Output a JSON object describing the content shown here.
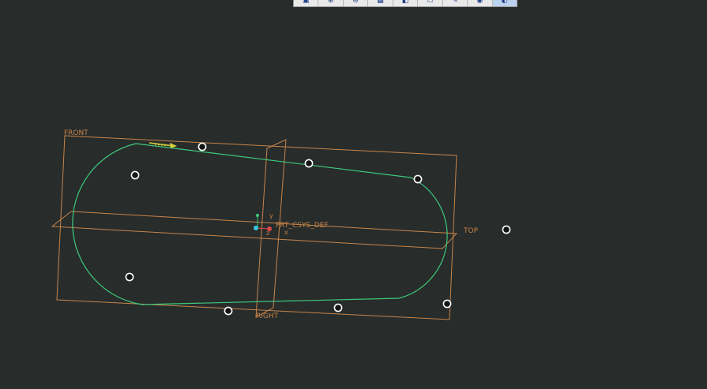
{
  "datum_planes": {
    "front": "FRONT",
    "top": "TOP",
    "right": "RIGHT"
  },
  "csys": {
    "name": "PRT_CSYS_DEF",
    "x_axis": "x",
    "y_axis": "y",
    "z_axis": "z"
  },
  "toolbar": {
    "buttons": [
      {
        "icon": "zoom-fit-icon"
      },
      {
        "icon": "zoom-in-icon"
      },
      {
        "icon": "zoom-out-icon"
      },
      {
        "icon": "saved-views-icon"
      },
      {
        "icon": "display-style-icon"
      },
      {
        "icon": "datum-display-icon"
      },
      {
        "icon": "annotation-display-icon"
      },
      {
        "icon": "spin-center-icon"
      },
      {
        "icon": "view-manager-icon"
      }
    ]
  },
  "colors": {
    "background": "#282c2b",
    "datum": "#c7844a",
    "sketch": "#3ec97a",
    "arrow": "#d8d13a",
    "handle": "#ffffff"
  }
}
